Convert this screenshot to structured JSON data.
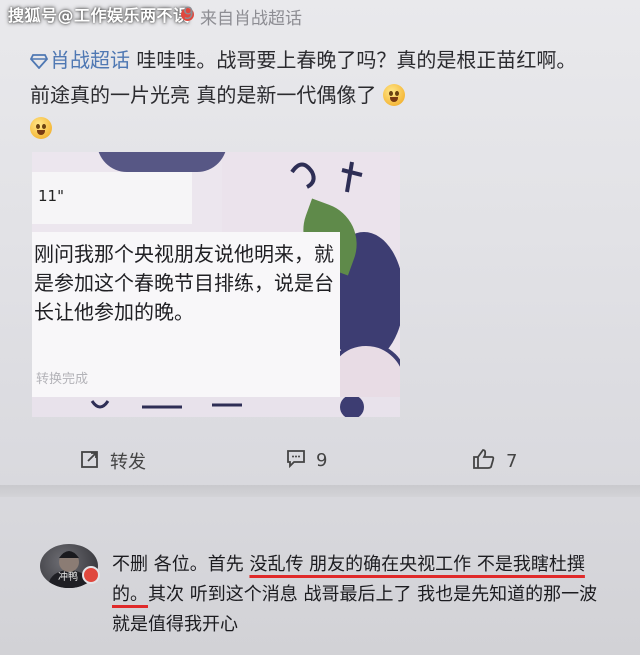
{
  "header": {
    "watermark": "搜狐号@工作娱乐两不误",
    "num": "9",
    "source": "来自肖战超话"
  },
  "post": {
    "topic": "肖战超话",
    "text": " 哇哇哇。战哥要上春晚了吗？真的是根正苗红啊。前途真的一片光亮 真的是新一代偶像了"
  },
  "image": {
    "time": "11\"",
    "message": "刚问我那个央视朋友说他明来，就是参加这个春晚节目排练，说是台长让他参加的晚。",
    "note": "转换完成"
  },
  "actions": {
    "repost": "转发",
    "comments": "9",
    "likes": "7"
  },
  "reply": {
    "avatar_label": "冲鸭",
    "part1": "不删 各位。首先 ",
    "part2": "没乱传 朋友的确在央视工作 不是我瞎杜撰的。",
    "part3": "其次 听到这个消息 战哥最后上了 我也是先知道的那一波 就是值得我开心"
  },
  "colors": {
    "topic": "#4f78b3",
    "underline": "#e02a2a"
  },
  "icons": [
    "gem-icon",
    "emoji-icon",
    "repost-icon",
    "comment-icon",
    "like-icon"
  ]
}
